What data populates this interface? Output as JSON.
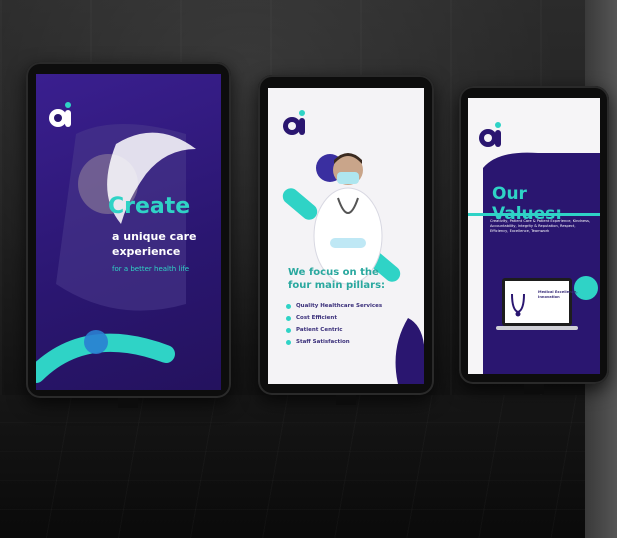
{
  "scene": {
    "description_colors": {
      "purple": "#2a1670",
      "teal": "#2fd3c6",
      "white": "#f4f3f6"
    }
  },
  "poster_left": {
    "logo_icon": "ai-logo",
    "title": "Create",
    "subtitle": "a unique care experience",
    "tagline": "for a better health life"
  },
  "poster_middle": {
    "logo_icon": "ai-logo",
    "heading": "We focus on the four main pillars:",
    "pillars": [
      "Quality Healthcare Services",
      "Cost Efficient",
      "Patient Centric",
      "Staff Satisfaction"
    ]
  },
  "poster_right": {
    "logo_icon": "ai-logo",
    "heading": "Our Values:",
    "values_text": "Creativity, Patient Care & Patient Experience, Kindness, Accountability, Integrity & Reputation, Respect, Efficiency, Excellence, Teamwork",
    "laptop_text": "Medical Excellence, Innovation"
  }
}
